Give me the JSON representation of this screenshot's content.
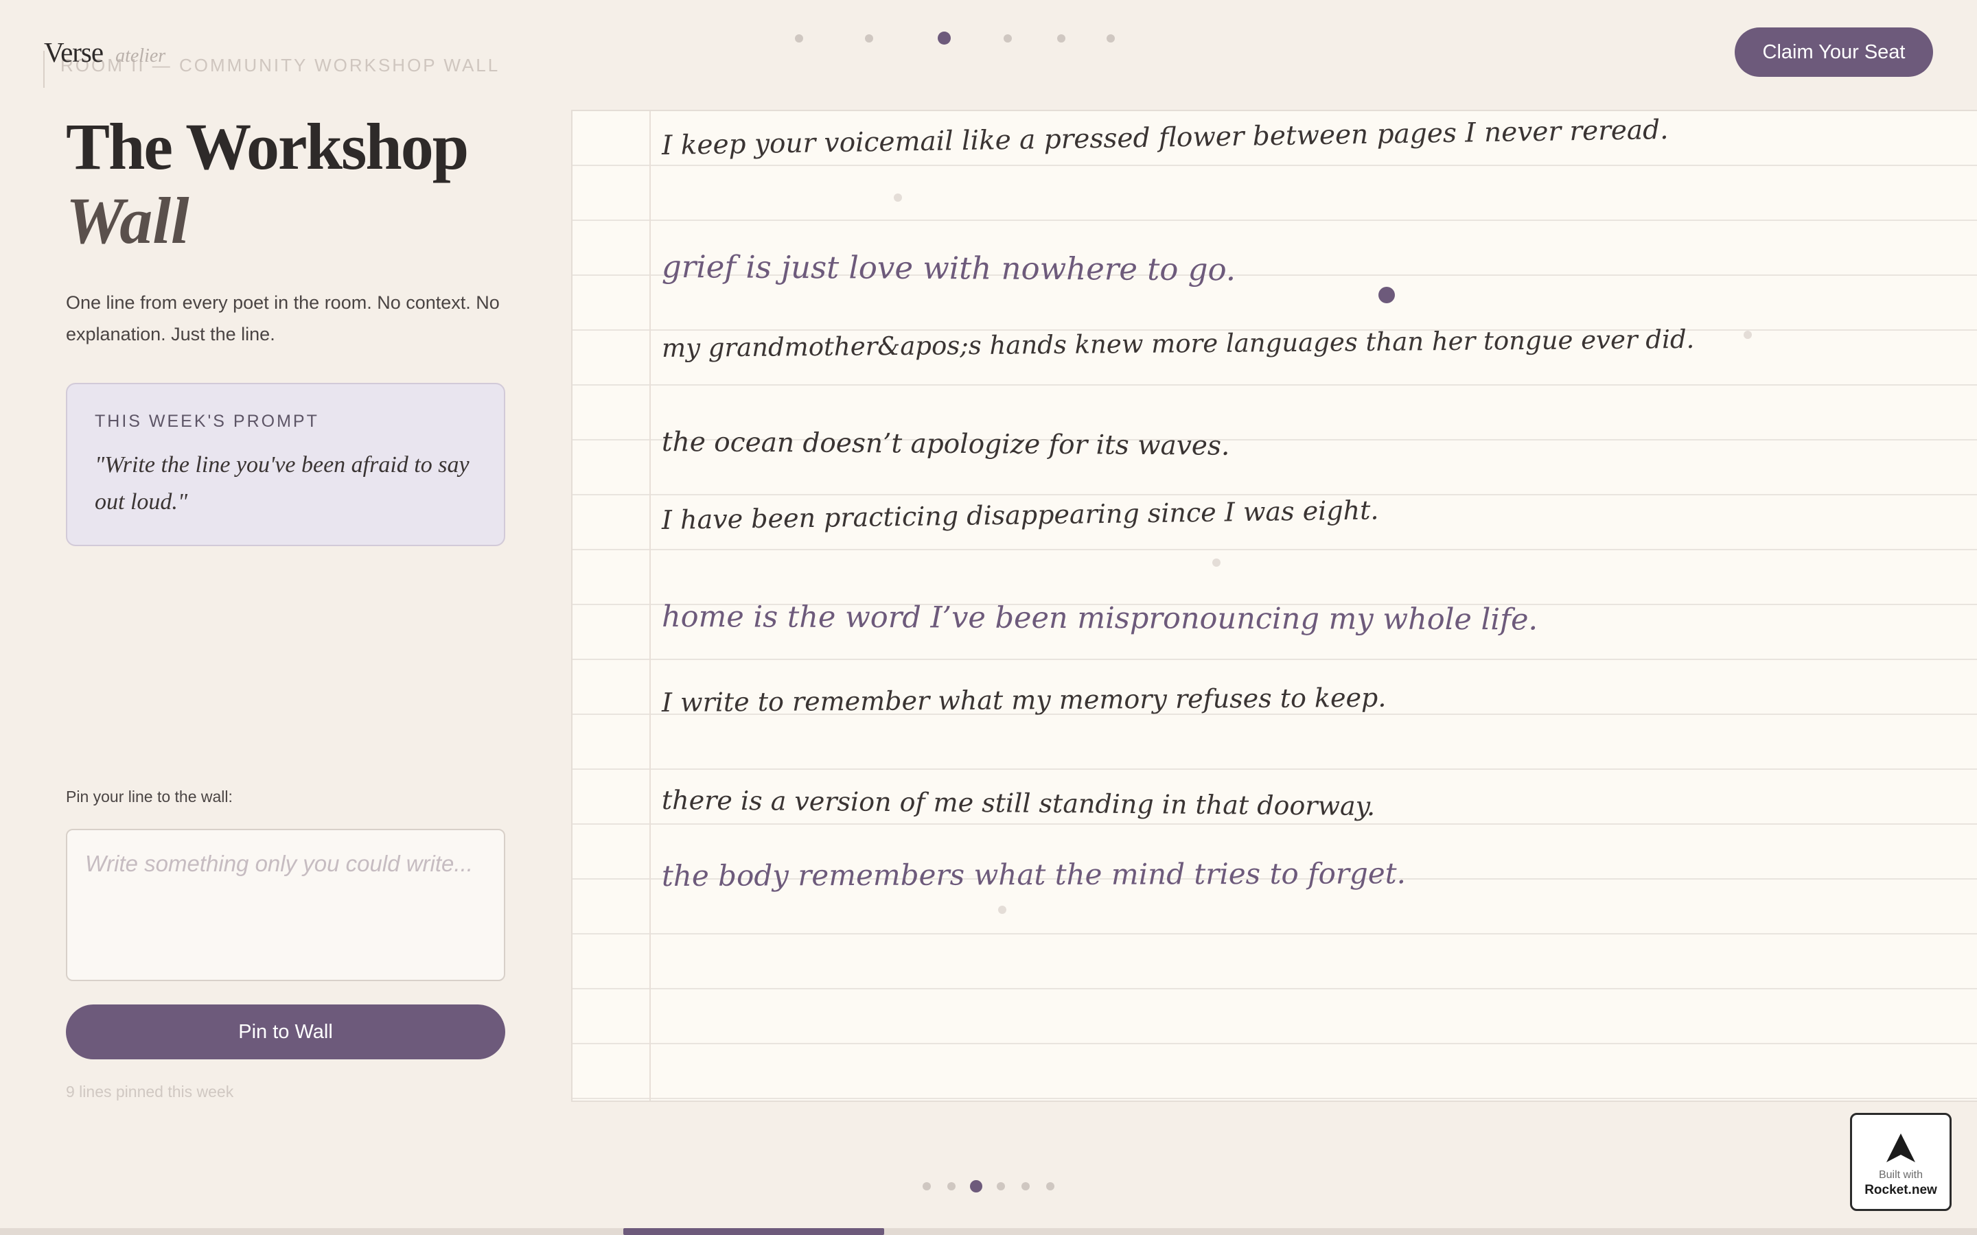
{
  "header": {
    "brand_name": "Verse",
    "brand_sub": "atelier",
    "room_label": "ROOM II — COMMUNITY WORKSHOP WALL",
    "cta_label": "Claim Your Seat",
    "slide_count": 6,
    "active_slide": 3
  },
  "intro": {
    "title_line1": "The Workshop",
    "title_line2": "Wall",
    "description": "One line from every poet in the room. No context. No explanation. Just the line."
  },
  "prompt": {
    "label": "THIS WEEK'S PROMPT",
    "text": "\"Write the line you've been afraid to say out loud.\""
  },
  "pin_form": {
    "label": "Pin your line to the wall:",
    "placeholder": "Write something only you could write...",
    "button_label": "Pin to Wall",
    "count_text": "9 lines pinned this week"
  },
  "wall": {
    "lines": [
      {
        "text": "I keep your voicemail like a pressed flower between pages I never reread.",
        "accent": false
      },
      {
        "text": "grief is just love with nowhere to go.",
        "accent": true
      },
      {
        "text": "my grandmother&apos;s hands knew more languages than her tongue ever did.",
        "accent": false
      },
      {
        "text": "the ocean doesn’t apologize for its waves.",
        "accent": false
      },
      {
        "text": "I have been practicing disappearing since I was eight.",
        "accent": false
      },
      {
        "text": "home is the word I’ve been mispronouncing my whole life.",
        "accent": true
      },
      {
        "text": "I write to remember what my memory refuses to keep.",
        "accent": false
      },
      {
        "text": "there is a version of me still standing in that doorway.",
        "accent": false
      },
      {
        "text": "the body remembers what the mind tries to forget.",
        "accent": true
      }
    ]
  },
  "badge": {
    "built_with": "Built with",
    "name": "Rocket.new"
  },
  "colors": {
    "background": "#f5efe8",
    "accent": "#6d5a7b",
    "paper": "#fdfaf4",
    "prompt_card": "#e9e5ef"
  }
}
